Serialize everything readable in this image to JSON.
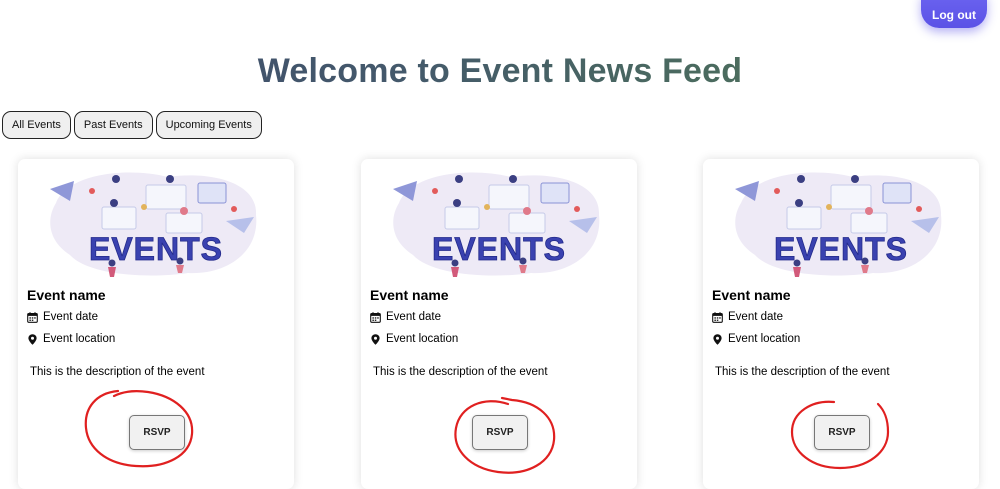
{
  "header": {
    "logout_label": "Log out",
    "title": "Welcome to Event News Feed"
  },
  "filters": [
    "All Events",
    "Past Events",
    "Upcoming Events"
  ],
  "events": [
    {
      "image_text": "EVENTS",
      "name": "Event name",
      "date": "Event date",
      "location": "Event location",
      "description": "This is the description of the event",
      "rsvp_label": "RSVP"
    },
    {
      "image_text": "EVENTS",
      "name": "Event name",
      "date": "Event date",
      "location": "Event location",
      "description": "This is the description of the event",
      "rsvp_label": "RSVP"
    },
    {
      "image_text": "EVENTS",
      "name": "Event name",
      "date": "Event date",
      "location": "Event location",
      "description": "This is the description of the event",
      "rsvp_label": "RSVP"
    }
  ],
  "colors": {
    "accent": "#5b52e6",
    "annotation": "#e02020",
    "title_start": "#3e4a6c",
    "title_end": "#56785a"
  },
  "icons": {
    "date": "calendar-icon",
    "location": "map-pin-icon"
  }
}
